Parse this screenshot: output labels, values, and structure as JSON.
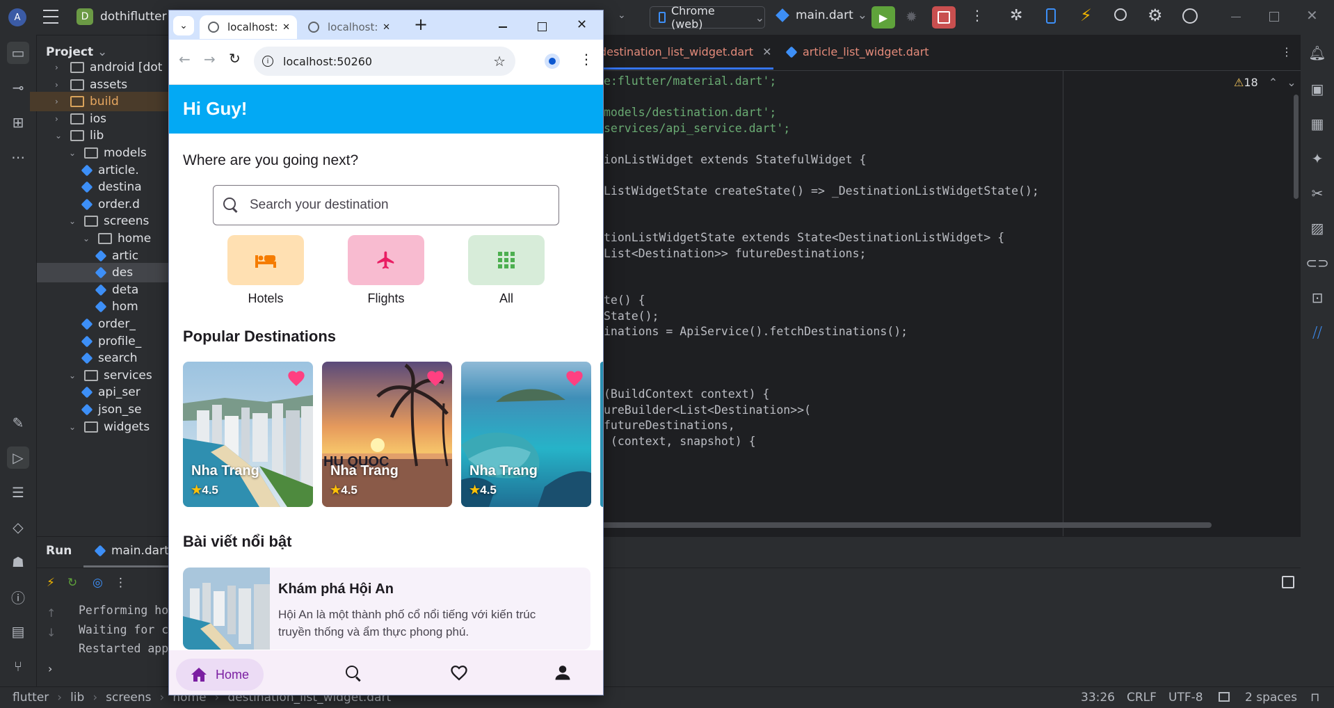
{
  "ide": {
    "project_name": "dothiflutter",
    "project_initial": "D",
    "device": "Chrome (web)",
    "run_config": "main.dart",
    "panel_title": "Project",
    "editor_tabs": [
      "destination_list_widget.dart",
      "article_list_widget.dart"
    ],
    "warnings_count": "18",
    "tree": [
      {
        "label": "android [dot",
        "type": "folder"
      },
      {
        "label": "assets",
        "type": "folder"
      },
      {
        "label": "build",
        "type": "folder"
      },
      {
        "label": "ios",
        "type": "folder"
      },
      {
        "label": "lib",
        "type": "folder"
      },
      {
        "label": "models",
        "type": "folder"
      },
      {
        "label": "article.",
        "type": "dart"
      },
      {
        "label": "destina",
        "type": "dart"
      },
      {
        "label": "order.d",
        "type": "dart"
      },
      {
        "label": "screens",
        "type": "folder"
      },
      {
        "label": "home",
        "type": "folder"
      },
      {
        "label": "artic",
        "type": "dart"
      },
      {
        "label": "des",
        "type": "dart"
      },
      {
        "label": "deta",
        "type": "dart"
      },
      {
        "label": "hom",
        "type": "dart"
      },
      {
        "label": "order_",
        "type": "dart"
      },
      {
        "label": "profile_",
        "type": "dart"
      },
      {
        "label": "search",
        "type": "dart"
      },
      {
        "label": "services",
        "type": "folder"
      },
      {
        "label": "api_ser",
        "type": "dart"
      },
      {
        "label": "json_se",
        "type": "dart"
      },
      {
        "label": "widgets",
        "type": "folder"
      }
    ],
    "code_lines": [
      "e:flutter/material.dart';",
      "",
      "models/destination.dart';",
      "services/api_service.dart';",
      "",
      "ionListWidget extends StatefulWidget {",
      "",
      "ListWidgetState createState() => _DestinationListWidgetState();",
      "",
      "",
      "tionListWidgetState extends State<DestinationListWidget> {",
      "List<Destination>> futureDestinations;",
      "",
      "",
      "te() {",
      "State();",
      "inations = ApiService().fetchDestinations();",
      "",
      "",
      "",
      "(BuildContext context) {",
      "ureBuilder<List<Destination>>(",
      "futureDestinations,",
      " (context, snapshot) {"
    ],
    "run": {
      "tab_run": "Run",
      "tab_main": "main.dart",
      "console_lines": [
        "Performing ho",
        "Waiting for c",
        "Restarted app"
      ]
    },
    "status": {
      "breadcrumb": [
        "flutter",
        "lib",
        "screens",
        "home",
        "destination_list_widget.dart"
      ],
      "position": "33:26",
      "line_ending": "CRLF",
      "encoding": "UTF-8",
      "indent": "2 spaces"
    }
  },
  "browser": {
    "tabs": [
      {
        "title": "localhost:",
        "active": true
      },
      {
        "title": "localhost:",
        "active": false
      }
    ],
    "url": "localhost:50260",
    "app": {
      "greeting": "Hi Guy!",
      "question": "Where are you going next?",
      "search_placeholder": "Search your destination",
      "categories": [
        {
          "label": "Hotels",
          "icon": "hotel-bed-icon",
          "bg": "#ffe0b2",
          "fg": "#f57c00"
        },
        {
          "label": "Flights",
          "icon": "airplane-icon",
          "bg": "#f8bbd0",
          "fg": "#e91e63"
        },
        {
          "label": "All",
          "icon": "grid-icon",
          "bg": "#d7ecd9",
          "fg": "#4caf50"
        }
      ],
      "popular_title": "Popular Destinations",
      "destinations": [
        {
          "name": "Nha Trang",
          "rating": "4.5"
        },
        {
          "name": "Nha Trang",
          "rating": "4.5"
        },
        {
          "name": "Nha Trang",
          "rating": "4.5"
        }
      ],
      "card_overlay_text": "HU QUOC",
      "articles_title": "Bài viết nổi bật",
      "article": {
        "title": "Khám phá Hội An",
        "description": "Hội An là một thành phố cổ nổi tiếng với kiến trúc truyền thống và ẩm thực phong phú."
      },
      "nav": {
        "home": "Home"
      }
    }
  },
  "colors": {
    "app_bar": "#03a9f4",
    "heart": "#ff4081",
    "nav_active": "#7b1fa2"
  }
}
